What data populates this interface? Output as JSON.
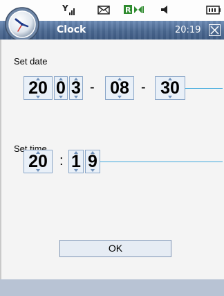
{
  "titlebar": {
    "app_name": "Clock",
    "time": "20:19"
  },
  "date_section": {
    "label": "Set date",
    "year_digits": [
      "20",
      "0",
      "3"
    ],
    "month": "08",
    "day": "30",
    "separator": "-"
  },
  "time_section": {
    "label": "Set time",
    "hour": "20",
    "minute_digits": [
      "1",
      "9"
    ],
    "separator": ":"
  },
  "ok_label": "OK",
  "icons": {
    "status": [
      "signal-icon",
      "mail-icon",
      "roaming-icon",
      "volume-icon",
      "battery-icon"
    ],
    "app": "clock-icon",
    "close": "close-icon"
  },
  "colors": {
    "titlebar": "#4e6c95",
    "accent_line": "#3fa9dd",
    "digit_box": "#e9f0f8"
  }
}
